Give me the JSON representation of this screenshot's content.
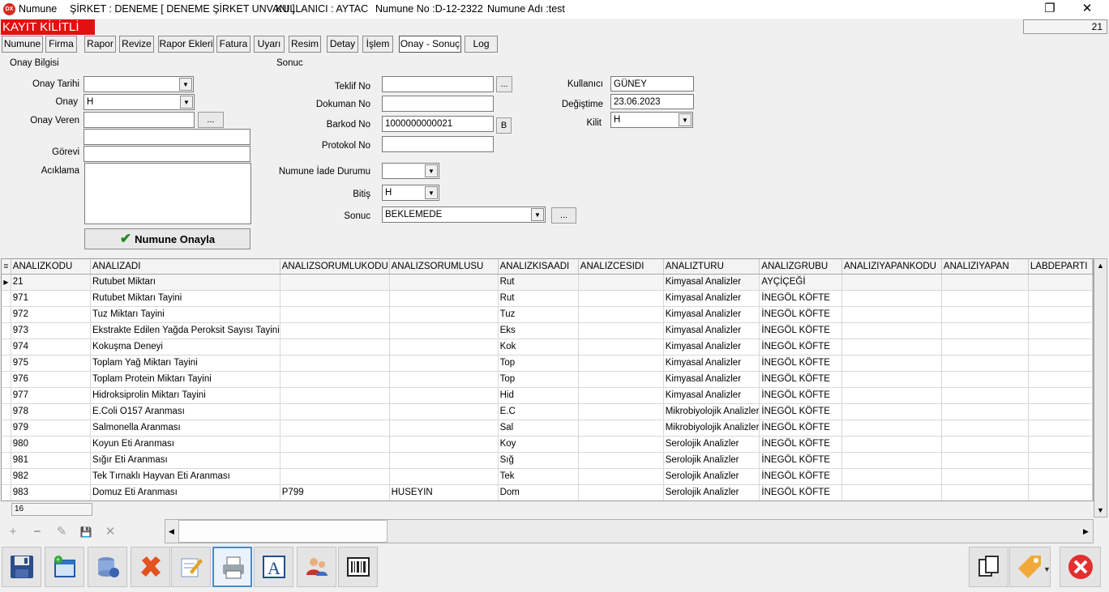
{
  "titlebar": {
    "app": "Numune",
    "company": "ŞİRKET : DENEME [ DENEME ŞİRKET UNVANI ]",
    "user": "KULLANICI : AYTAC",
    "sample_no": "Numune No :D-12-2322",
    "sample_name": "Numune Adı :test",
    "restore_glyph": "❐",
    "close_glyph": "✕"
  },
  "locked_banner": "KAYIT KİLİTLİ",
  "record_counter": "21",
  "tabs": [
    "Numune",
    "Firma",
    "Rapor",
    "Revize",
    "Rapor Ekleri",
    "Fatura",
    "Uyarı",
    "Resim",
    "Detay",
    "İşlem",
    "Onay - Sonuç",
    "Log"
  ],
  "active_tab": "Onay - Sonuç",
  "onay": {
    "group_title": "Onay Bilgisi",
    "tarih_label": "Onay Tarihi",
    "tarih_value": "",
    "onay_label": "Onay",
    "onay_value": "H",
    "veren_label": "Onay Veren",
    "veren_value": "",
    "veren_extra": "",
    "gorevi_label": "Görevi",
    "gorevi_value": "",
    "aciklama_label": "Acıklama",
    "aciklama_value": "",
    "dots": "...",
    "approve_button": "Numune Onayla"
  },
  "sonuc": {
    "group_title": "Sonuc",
    "teklif_label": "Teklif No",
    "teklif_value": "",
    "dokuman_label": "Dokuman No",
    "dokuman_value": "",
    "barkod_label": "Barkod No",
    "barkod_value": "1000000000021",
    "barkod_btn": "B",
    "protokol_label": "Protokol No",
    "protokol_value": "",
    "iade_label": "Numune İade Durumu",
    "iade_value": "",
    "bitis_label": "Bitiş",
    "bitis_value": "H",
    "sonuc_label": "Sonuc",
    "sonuc_value": "BEKLEMEDE",
    "kullanici_label": "Kullanıcı",
    "kullanici_value": "GÜNEY",
    "degistime_label": "Değiştime",
    "degistime_value": "23.06.2023",
    "kilit_label": "Kilit",
    "kilit_value": "H",
    "dots": "...",
    "dots2": "..."
  },
  "grid": {
    "columns": [
      "ANALIZKODU",
      "ANALIZADI",
      "ANALIZSORUMLUKODU",
      "ANALIZSORUMLUSU",
      "ANALIZKISAADI",
      "ANALIZCESIDI",
      "ANALIZTURU",
      "ANALIZGRUBU",
      "ANALIZIYAPANKODU",
      "ANALIZIYAPAN",
      "LABDEPARTI"
    ],
    "rows": [
      [
        "21",
        "Rutubet Miktarı",
        "",
        "",
        "Rut",
        "",
        "Kimyasal Analizler",
        "AYÇİÇEĞİ",
        "",
        "",
        ""
      ],
      [
        "971",
        "Rutubet Miktarı Tayini",
        "",
        "",
        "Rut",
        "",
        "Kimyasal Analizler",
        "İNEGÖL KÖFTE",
        "",
        "",
        ""
      ],
      [
        "972",
        "Tuz Miktarı Tayini",
        "",
        "",
        "Tuz",
        "",
        "Kimyasal Analizler",
        "İNEGÖL KÖFTE",
        "",
        "",
        ""
      ],
      [
        "973",
        "Ekstrakte Edilen Yağda Peroksit Sayısı Tayini",
        "",
        "",
        "Eks",
        "",
        "Kimyasal Analizler",
        "İNEGÖL KÖFTE",
        "",
        "",
        ""
      ],
      [
        "974",
        "Kokuşma Deneyi",
        "",
        "",
        "Kok",
        "",
        "Kimyasal Analizler",
        "İNEGÖL KÖFTE",
        "",
        "",
        ""
      ],
      [
        "975",
        "Toplam Yağ Miktarı Tayini",
        "",
        "",
        "Top",
        "",
        "Kimyasal Analizler",
        "İNEGÖL KÖFTE",
        "",
        "",
        ""
      ],
      [
        "976",
        "Toplam Protein Miktarı Tayini",
        "",
        "",
        "Top",
        "",
        "Kimyasal Analizler",
        "İNEGÖL KÖFTE",
        "",
        "",
        ""
      ],
      [
        "977",
        "Hidroksiprolin Miktarı Tayini",
        "",
        "",
        "Hid",
        "",
        "Kimyasal Analizler",
        "İNEGÖL KÖFTE",
        "",
        "",
        ""
      ],
      [
        "978",
        "E.Coli O157 Aranması",
        "",
        "",
        "E.C",
        "",
        "Mikrobiyolojik Analizler",
        "İNEGÖL KÖFTE",
        "",
        "",
        ""
      ],
      [
        "979",
        "Salmonella Aranması",
        "",
        "",
        "Sal",
        "",
        "Mikrobiyolojik Analizler",
        "İNEGÖL KÖFTE",
        "",
        "",
        ""
      ],
      [
        "980",
        "Koyun Eti Aranması",
        "",
        "",
        "Koy",
        "",
        "Serolojik Analizler",
        "İNEGÖL KÖFTE",
        "",
        "",
        ""
      ],
      [
        "981",
        "Sığır Eti Aranması",
        "",
        "",
        "Sığ",
        "",
        "Serolojik Analizler",
        "İNEGÖL KÖFTE",
        "",
        "",
        ""
      ],
      [
        "982",
        "Tek Tırnaklı Hayvan Eti Aranması",
        "",
        "",
        "Tek",
        "",
        "Serolojik Analizler",
        "İNEGÖL KÖFTE",
        "",
        "",
        ""
      ],
      [
        "983",
        "Domuz Eti Aranması",
        "P799",
        "HUSEYIN",
        "Dom",
        "",
        "Serolojik Analizler",
        "İNEGÖL KÖFTE",
        "",
        "",
        ""
      ]
    ],
    "footer_count": "16"
  },
  "navigator": [
    "+",
    "−",
    "✎",
    "💾",
    "✕"
  ],
  "toolbar": [
    "save-icon",
    "new-window-icon",
    "database-delete-icon",
    "delete-icon",
    "edit-icon",
    "print-icon",
    "font-icon",
    "users-icon",
    "barcode-icon",
    "copy-icon",
    "tag-icon",
    "close-icon"
  ],
  "colors": {
    "locked": "#e21010",
    "accent": "#4a8ad0"
  }
}
